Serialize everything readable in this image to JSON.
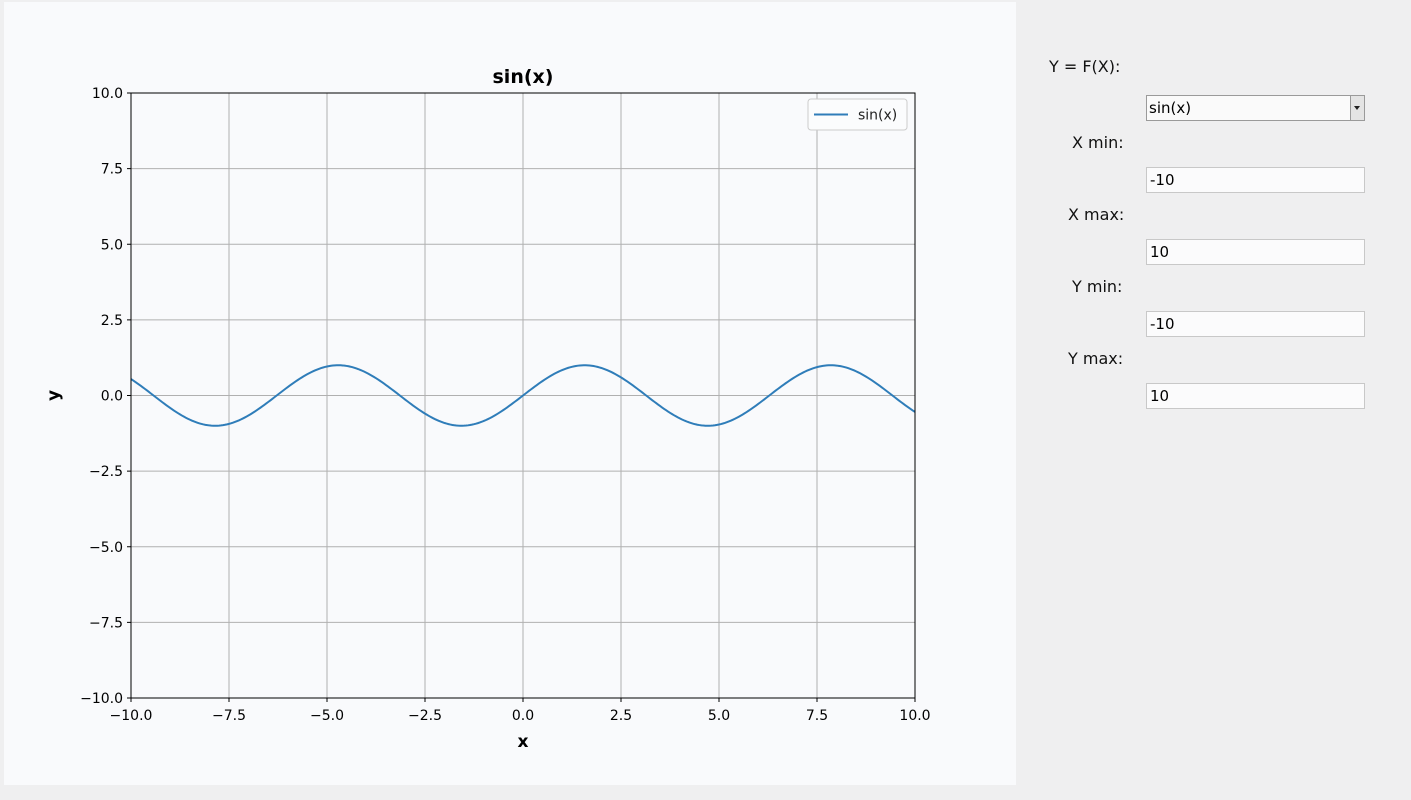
{
  "controls": {
    "function_label": "Y = F(X):",
    "function_value": "sin(x)",
    "xmin_label": "X min:",
    "xmin_value": "-10",
    "xmax_label": "X max:",
    "xmax_value": "10",
    "ymin_label": "Y min:",
    "ymin_value": "-10",
    "ymax_label": "Y max:",
    "ymax_value": "10"
  },
  "colors": {
    "series": "#2f7db9",
    "grid": "#b0b0b0",
    "plot_background": "#f9fafc",
    "panel_background": "#efeff0"
  },
  "chart_data": {
    "type": "line",
    "title": "sin(x)",
    "xlabel": "x",
    "ylabel": "y",
    "xlim": [
      -10,
      10
    ],
    "ylim": [
      -10,
      10
    ],
    "grid": true,
    "legend_placement": "upper-right",
    "x_ticks": [
      -10,
      -7.5,
      -5,
      -2.5,
      0,
      2.5,
      5,
      7.5,
      10
    ],
    "x_tick_labels": [
      "−10.0",
      "−7.5",
      "−5.0",
      "−2.5",
      "0.0",
      "2.5",
      "5.0",
      "7.5",
      "10.0"
    ],
    "y_ticks": [
      10,
      7.5,
      5,
      2.5,
      0,
      -2.5,
      -5,
      -7.5,
      -10
    ],
    "y_tick_labels": [
      "10.0",
      "7.5",
      "5.0",
      "2.5",
      "0.0",
      "−2.5",
      "−5.0",
      "−7.5",
      "−10.0"
    ],
    "series": [
      {
        "name": "sin(x)",
        "function": "sin",
        "x_range": [
          -10,
          10
        ],
        "color": "#2f7db9"
      }
    ]
  }
}
